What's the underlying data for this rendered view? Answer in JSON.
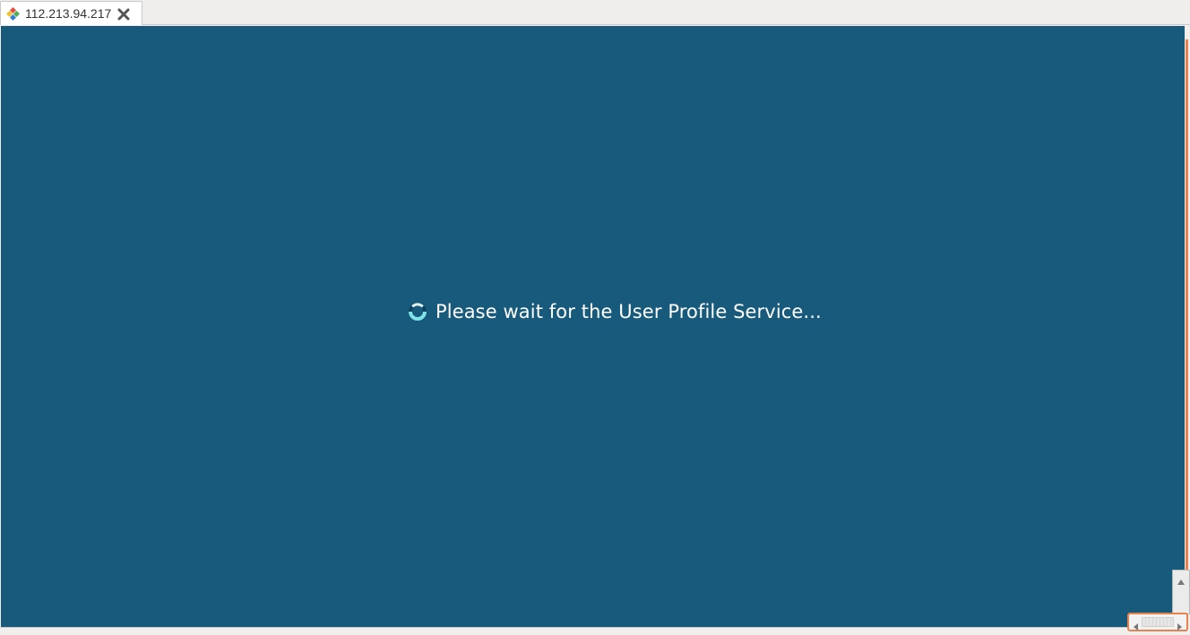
{
  "tab": {
    "title": "112.213.94.217",
    "icon": "remote-desktop-icon",
    "close_icon": "close-icon"
  },
  "remote_screen": {
    "background_color": "#185a7c",
    "status_text": "Please wait for the User Profile Service...",
    "spinner_icon": "loading-spinner-icon"
  },
  "colors": {
    "accent": "#e8824f",
    "text": "#ffffff"
  }
}
